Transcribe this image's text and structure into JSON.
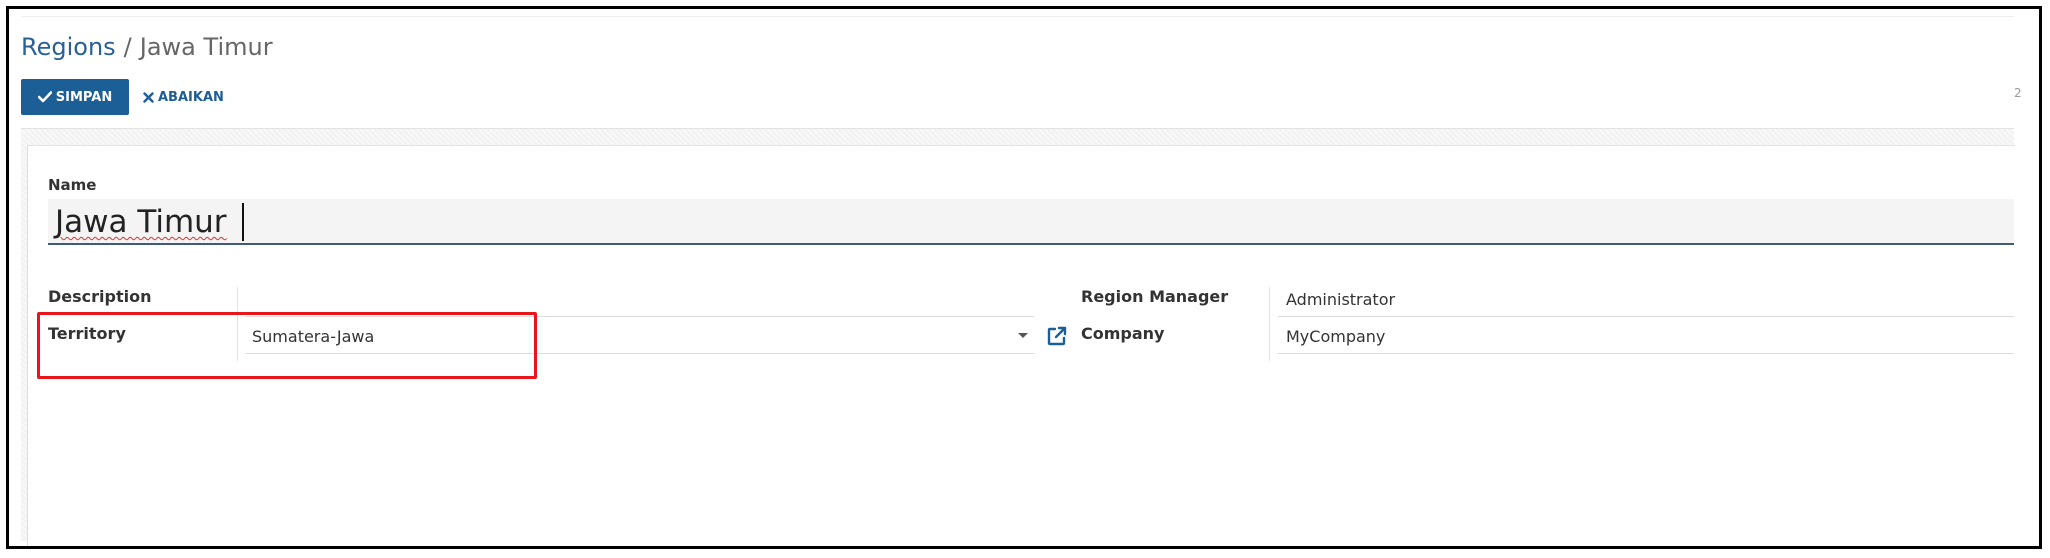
{
  "breadcrumb": {
    "parent": "Regions",
    "separator": "/",
    "current": "Jawa Timur"
  },
  "toolbar": {
    "save_label": "SIMPAN",
    "save_icon": "check-icon",
    "discard_label": "ABAIKAN",
    "discard_icon": "times-icon",
    "pager_hint": "2"
  },
  "form": {
    "name_label": "Name",
    "name_value": "Jawa Timur",
    "description_label": "Description",
    "description_value": "",
    "territory_label": "Territory",
    "territory_value": "Sumatera-Jawa",
    "territory_dropdown_icon": "caret-down-icon",
    "territory_external_icon": "external-link-icon",
    "region_manager_label": "Region Manager",
    "region_manager_value": "Administrator",
    "company_label": "Company",
    "company_value": "MyCompany"
  },
  "colors": {
    "primary": "#1c5e96",
    "link": "#2a6194",
    "highlight": "#e8161b",
    "input_underline": "#3e5a7e"
  }
}
